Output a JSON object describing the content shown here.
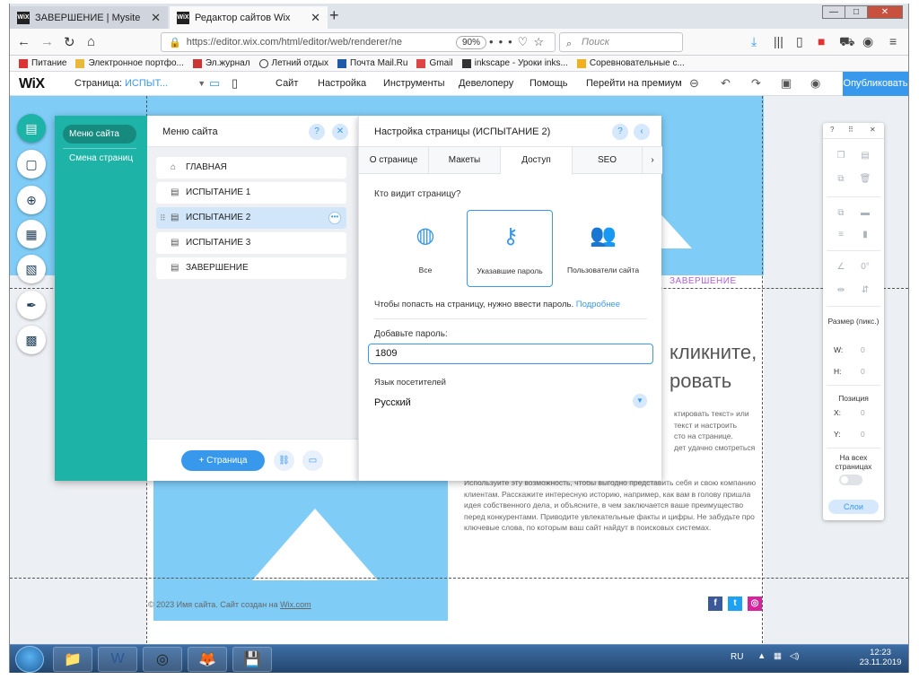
{
  "browser": {
    "tabs": [
      {
        "label": "ЗАВЕРШЕНИЕ | Mysite",
        "favicon": "wix-icon"
      },
      {
        "label": "Редактор сайтов Wix",
        "favicon": "wix-icon"
      }
    ],
    "url": "https://editor.wix.com/html/editor/web/renderer/ne",
    "zoom": "90%",
    "search_placeholder": "Поиск",
    "bookmarks": [
      "Питание",
      "Электронное портфо...",
      "Эл.журнал",
      "Летний отдых",
      "Почта Mail.Ru",
      "Gmail",
      "inkscape - Уроки inks...",
      "Соревновательные с..."
    ]
  },
  "wix": {
    "logo": "WiX",
    "page_label": "Страница:",
    "page_value": "ИСПЫТ...",
    "menu": [
      "Сайт",
      "Настройка",
      "Инструменты",
      "Девелоперу",
      "Помощь",
      "Перейти на премиум"
    ],
    "publish": "Опубликовать"
  },
  "menu_panel": {
    "side_active": "Меню сайта",
    "side_item": "Смена страниц",
    "title": "Меню сайта",
    "pages": [
      "ГЛАВНАЯ",
      "ИСПЫТАНИЕ 1",
      "ИСПЫТАНИЕ 2",
      "ИСПЫТАНИЕ 3",
      "ЗАВЕРШЕНИЕ"
    ],
    "selected_page": "ИСПЫТАНИЕ 2",
    "add_page": "+ Страница"
  },
  "settings_panel": {
    "title": "Настройка страницы (ИСПЫТАНИЕ 2)",
    "tabs": [
      "О странице",
      "Макеты",
      "Доступ",
      "SEO"
    ],
    "active_tab": "Доступ",
    "who_sees": "Кто видит страницу?",
    "access_options": [
      "Все",
      "Указавшие пароль",
      "Пользователи сайта"
    ],
    "selected_access": "Указавшие пароль",
    "hint": "Чтобы попасть на страницу, нужно ввести пароль.",
    "hint_link": "Подробнее",
    "password_label": "Добавьте пароль:",
    "password_value": "1809",
    "lang_label": "Язык посетителей",
    "lang_value": "Русский"
  },
  "site": {
    "nav_item": "ЗАВЕРШЕНИЕ",
    "title_line1": "кликните,",
    "title_line2": "ровать",
    "body1": [
      "ктировать текст» или",
      "текст и настроить",
      "сто на странице.",
      "дет удачно смотреться"
    ],
    "body2": "Используйте эту возможность, чтобы выгодно представить себя и свою компанию клиентам. Расскажите интересную историю, например, как вам в голову пришла идея собственного дела, и объясните, в чем заключается ваше преимущество перед конкурентами. Приводите увлекательные факты и цифры. Не забудьте про ключевые слова, по которым ваш сайт найдут в поисковых системах.",
    "footer_text": "© 2023 Имя сайта. Сайт создан на",
    "footer_link": "Wix.com"
  },
  "tool_panel": {
    "size_label": "Размер (пикс.)",
    "w_label": "W:",
    "w_value": "0",
    "h_label": "H:",
    "h_value": "0",
    "pos_label": "Позиция",
    "x_label": "X:",
    "x_value": "0",
    "y_label": "Y:",
    "y_value": "0",
    "all_pages": "На всех страницах",
    "layers": "Слои",
    "angle": "0°"
  },
  "taskbar": {
    "lang": "RU",
    "time": "12:23",
    "date": "23.11.2019"
  }
}
